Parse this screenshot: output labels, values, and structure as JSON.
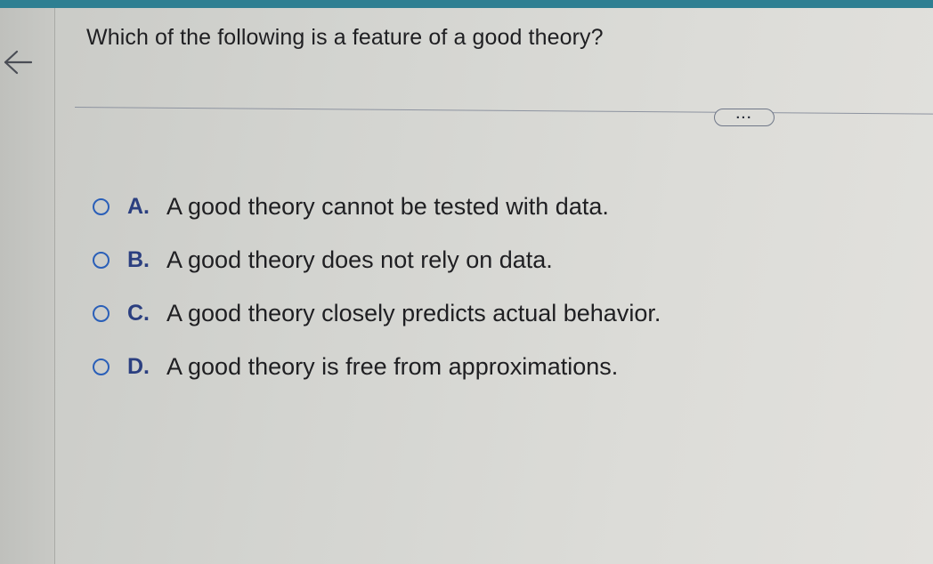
{
  "question": {
    "text": "Which of the following is a feature of a good theory?"
  },
  "navigation": {
    "back_icon": "arrow-left-icon"
  },
  "toolbar": {
    "more_label": "..."
  },
  "options": [
    {
      "letter": "A.",
      "text": "A good theory cannot be tested with data."
    },
    {
      "letter": "B.",
      "text": "A good theory does not rely on data."
    },
    {
      "letter": "C.",
      "text": "A good theory closely predicts actual behavior."
    },
    {
      "letter": "D.",
      "text": "A good theory is free from approximations."
    }
  ],
  "colors": {
    "accent_bar": "#2e7f92",
    "radio": "#2a5fb8",
    "letter": "#2b3f80"
  }
}
